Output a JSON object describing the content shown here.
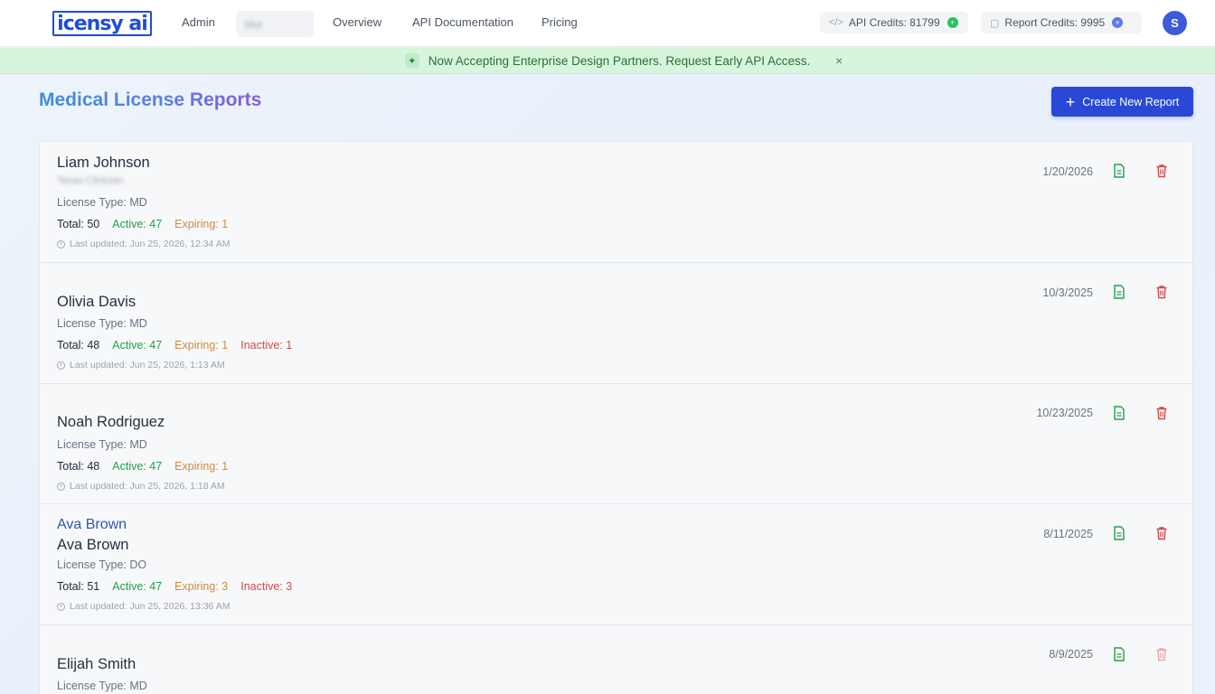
{
  "nav": {
    "logo": "icensy ai",
    "links": [
      "Admin",
      "Overview",
      "API Documentation",
      "Pricing"
    ],
    "blurred_pill": "blur",
    "api_credits": "API Credits: 81799",
    "report_credits": "Report Credits: 9995",
    "avatar_initial": "S"
  },
  "banner": {
    "message": "Now Accepting Enterprise Design Partners. Request Early API Access.",
    "close": "×"
  },
  "page": {
    "title": "Medical License Reports",
    "create_button": "Create New Report"
  },
  "colors": {
    "primary": "#2948d6",
    "active": "#22a04b",
    "expiring": "#d08a3a",
    "inactive": "#d14b4b",
    "banner_bg": "#d7f5dc"
  },
  "reports": [
    {
      "name": "Liam Johnson",
      "blurred_sub": "Texas Clinician",
      "license_type": "License Type: MD",
      "total": "Total: 50",
      "active": "Active: 47",
      "expiring": "Expiring: 1",
      "inactive": "",
      "updated": "Last updated: Jun 25, 2026, 12:34 AM",
      "date": "1/20/2026"
    },
    {
      "name": "Olivia Davis",
      "license_type": "License Type: MD",
      "total": "Total: 48",
      "active": "Active: 47",
      "expiring": "Expiring: 1",
      "inactive": "Inactive: 1",
      "updated": "Last updated: Jun 25, 2026, 1:13 AM",
      "date": "10/3/2025"
    },
    {
      "name": "Noah Rodriguez",
      "license_type": "License Type: MD",
      "total": "Total: 48",
      "active": "Active: 47",
      "expiring": "Expiring: 1",
      "inactive": "",
      "updated": "Last updated: Jun 25, 2026, 1:18 AM",
      "date": "10/23/2025"
    },
    {
      "link_name": "Ava Brown",
      "name": "Ava Brown",
      "license_type": "License Type: DO",
      "total": "Total: 51",
      "active": "Active: 47",
      "expiring": "Expiring: 3",
      "inactive": "Inactive: 3",
      "updated": "Last updated: Jun 25, 2026, 13:36 AM",
      "date": "8/11/2025"
    },
    {
      "name": "Elijah Smith",
      "license_type": "License Type: MD",
      "date": "8/9/2025"
    }
  ]
}
